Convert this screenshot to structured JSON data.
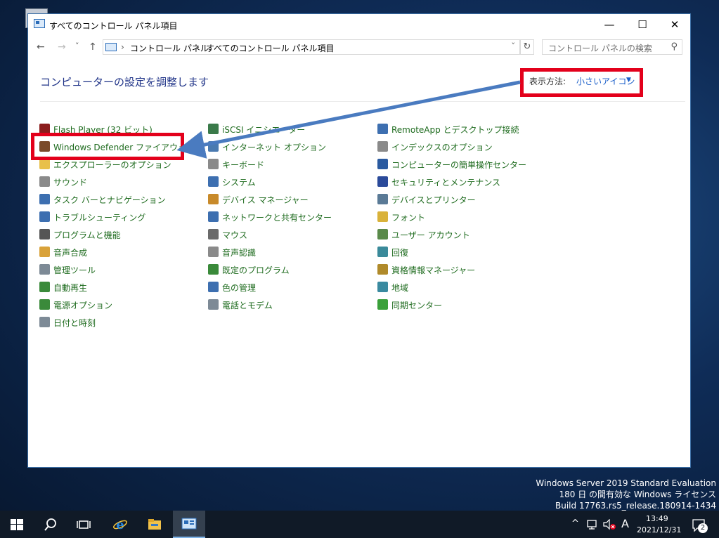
{
  "window": {
    "title": "すべてのコントロール パネル項目",
    "minimize": "—",
    "maximize": "☐",
    "close": "✕"
  },
  "nav": {
    "back": "←",
    "forward": "→",
    "recent": "˅",
    "up": "↑",
    "breadcrumbs": [
      "コントロール パネル",
      "すべてのコントロール パネル項目"
    ],
    "separator": "›",
    "dropdown": "˅",
    "refresh": "↻",
    "search_placeholder": "コントロール パネルの検索",
    "search_icon": "⚲"
  },
  "header": {
    "title": "コンピューターの設定を調整します",
    "view_by_label": "表示方法:",
    "view_by_value": "小さいアイコン",
    "view_by_arrow": "▼"
  },
  "columns": [
    {
      "items": [
        {
          "label": "Flash Player (32 ビット)",
          "icon": "flash-icon",
          "color": "#8b1d1d"
        },
        {
          "label": "Windows Defender ファイアウォール",
          "icon": "firewall-icon",
          "color": "#7a4a2a"
        },
        {
          "label": "エクスプローラーのオプション",
          "icon": "folder-icon",
          "color": "#e8c04a"
        },
        {
          "label": "サウンド",
          "icon": "speaker-icon",
          "color": "#8a8a8a"
        },
        {
          "label": "タスク バーとナビゲーション",
          "icon": "taskbar-icon",
          "color": "#3d6fb0"
        },
        {
          "label": "トラブルシューティング",
          "icon": "troubleshoot-icon",
          "color": "#3d6fb0"
        },
        {
          "label": "プログラムと機能",
          "icon": "programs-icon",
          "color": "#555555"
        },
        {
          "label": "音声合成",
          "icon": "speech-icon",
          "color": "#d9a23a"
        },
        {
          "label": "管理ツール",
          "icon": "admin-tools-icon",
          "color": "#7d8a96"
        },
        {
          "label": "自動再生",
          "icon": "autoplay-icon",
          "color": "#3a8a3a"
        },
        {
          "label": "電源オプション",
          "icon": "power-icon",
          "color": "#3a8a3a"
        },
        {
          "label": "日付と時刻",
          "icon": "calendar-icon",
          "color": "#7d8a96"
        }
      ]
    },
    {
      "items": [
        {
          "label": "iSCSI イニシエーター",
          "icon": "iscsi-icon",
          "color": "#3a7a4a"
        },
        {
          "label": "インターネット オプション",
          "icon": "internet-options-icon",
          "color": "#4a7ab0"
        },
        {
          "label": "キーボード",
          "icon": "keyboard-icon",
          "color": "#8a8a8a"
        },
        {
          "label": "システム",
          "icon": "system-icon",
          "color": "#3d6fb0"
        },
        {
          "label": "デバイス マネージャー",
          "icon": "device-manager-icon",
          "color": "#c88a2a"
        },
        {
          "label": "ネットワークと共有センター",
          "icon": "network-icon",
          "color": "#3d6fb0"
        },
        {
          "label": "マウス",
          "icon": "mouse-icon",
          "color": "#6a6a6a"
        },
        {
          "label": "音声認識",
          "icon": "microphone-icon",
          "color": "#8a8a8a"
        },
        {
          "label": "既定のプログラム",
          "icon": "default-programs-icon",
          "color": "#3a8a3a"
        },
        {
          "label": "色の管理",
          "icon": "color-management-icon",
          "color": "#3d6fb0"
        },
        {
          "label": "電話とモデム",
          "icon": "phone-icon",
          "color": "#7d8a96"
        }
      ]
    },
    {
      "items": [
        {
          "label": "RemoteApp とデスクトップ接続",
          "icon": "remoteapp-icon",
          "color": "#3d6fb0"
        },
        {
          "label": "インデックスのオプション",
          "icon": "indexing-icon",
          "color": "#8a8a8a"
        },
        {
          "label": "コンピューターの簡単操作センター",
          "icon": "ease-of-access-icon",
          "color": "#2a5aa0"
        },
        {
          "label": "セキュリティとメンテナンス",
          "icon": "flag-icon",
          "color": "#2a4a9a"
        },
        {
          "label": "デバイスとプリンター",
          "icon": "printer-icon",
          "color": "#5a7a96"
        },
        {
          "label": "フォント",
          "icon": "font-icon",
          "color": "#d9b23a"
        },
        {
          "label": "ユーザー アカウント",
          "icon": "user-accounts-icon",
          "color": "#5a8a4a"
        },
        {
          "label": "回復",
          "icon": "recovery-icon",
          "color": "#3a8a9a"
        },
        {
          "label": "資格情報マネージャー",
          "icon": "credential-icon",
          "color": "#b08a2a"
        },
        {
          "label": "地域",
          "icon": "globe-icon",
          "color": "#3a8aa0"
        },
        {
          "label": "同期センター",
          "icon": "sync-icon",
          "color": "#3aa03a"
        }
      ]
    }
  ],
  "watermark": {
    "line1": "Windows Server 2019 Standard Evaluation",
    "line2": "180 日 の間有効な Windows ライセンス",
    "line3": "Build 17763.rs5_release.180914-1434"
  },
  "taskbar": {
    "time": "13:49",
    "date": "2021/12/31",
    "ime": "A",
    "tray_chevron": "^",
    "notification_count": "2"
  },
  "colors": {
    "annotation_red": "#e3001b",
    "arrow_blue": "#4a7bc0",
    "link_green": "#1e6b1e",
    "heading_blue": "#1e3287"
  }
}
